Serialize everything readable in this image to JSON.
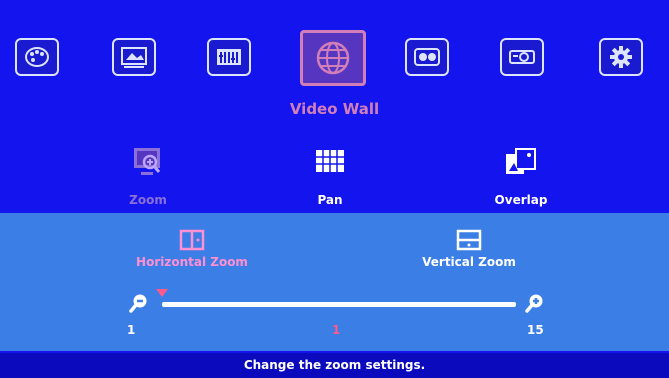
{
  "menu": {
    "categories": [
      {
        "icon": "palette-icon"
      },
      {
        "icon": "image-adjust-icon"
      },
      {
        "icon": "audio-mixer-icon"
      },
      {
        "icon": "globe-icon",
        "label": "Video Wall",
        "active": true
      },
      {
        "icon": "3d-icon"
      },
      {
        "icon": "projector-icon"
      },
      {
        "icon": "gear-icon"
      }
    ],
    "active_label": "Video Wall"
  },
  "submenu": {
    "items": [
      {
        "label": "Zoom",
        "icon": "zoom-screen-icon",
        "selected": true
      },
      {
        "label": "Pan",
        "icon": "grid-icon",
        "selected": false
      },
      {
        "label": "Overlap",
        "icon": "overlap-icon",
        "selected": false
      }
    ]
  },
  "zoom": {
    "modes": [
      {
        "label": "Horizontal Zoom",
        "icon": "horizontal-split-icon",
        "active": true
      },
      {
        "label": "Vertical Zoom",
        "icon": "vertical-split-icon",
        "active": false
      }
    ],
    "min": "1",
    "max": "15",
    "value": "1",
    "min_icon": "zoom-out-icon",
    "max_icon": "zoom-in-icon"
  },
  "status": "Change the zoom settings.",
  "colors": {
    "background": "#1414ee",
    "panel": "#3b7ee6",
    "accent": "#d27fb9",
    "status_bar": "#0b0bbd",
    "thumb": "#ff5a8a"
  }
}
